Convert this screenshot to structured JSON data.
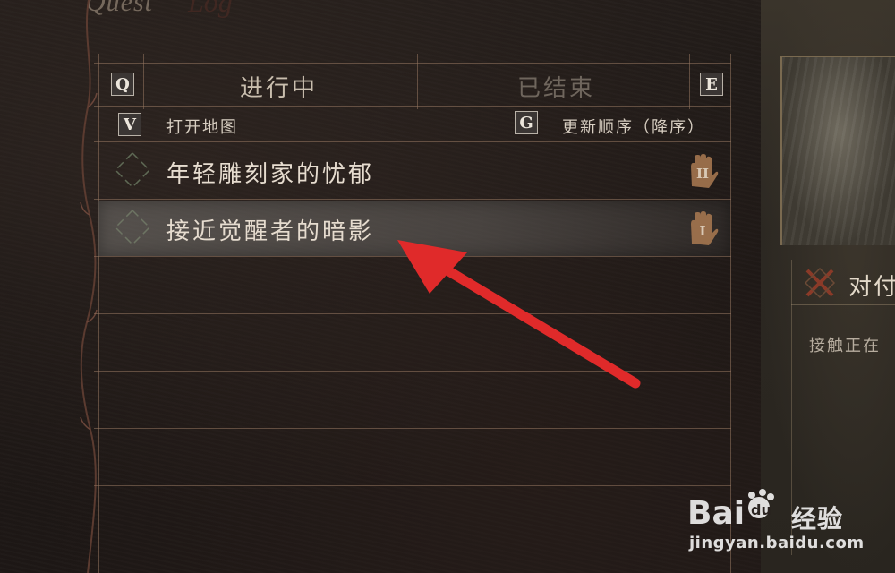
{
  "header": {
    "title": "Quest",
    "title_deco": "Log"
  },
  "tabs": [
    {
      "label": "进行中",
      "key": "Q",
      "active": true
    },
    {
      "label": "已结束",
      "key": "E",
      "active": false
    }
  ],
  "actions": {
    "open_map": {
      "key": "V",
      "label": "打开地图"
    },
    "sort": {
      "key": "G",
      "label": "更新顺序（降序）"
    }
  },
  "quests": [
    {
      "title": "年轻雕刻家的忧郁",
      "rank": "II",
      "selected": false
    },
    {
      "title": "接近觉醒者的暗影",
      "rank": "I",
      "selected": true
    }
  ],
  "detail": {
    "title": "对付",
    "description": "接触正在"
  },
  "watermark": {
    "brand": "Bai du 经验",
    "brand_cn": "经验",
    "url": "jingyan.baidu.com"
  },
  "colors": {
    "accent": "#e02a2a",
    "hand_icon": "#a4764f",
    "line": "#96765f"
  }
}
